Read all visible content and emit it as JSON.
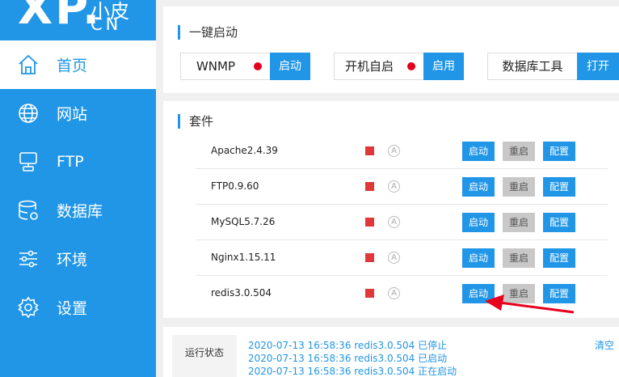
{
  "logo": {
    "big": "XP.",
    "small": "小皮",
    "cn": "CN"
  },
  "nav": [
    {
      "label": "首页",
      "icon": "home-icon",
      "active": true
    },
    {
      "label": "网站",
      "icon": "globe-icon",
      "active": false
    },
    {
      "label": "FTP",
      "icon": "server-icon",
      "active": false
    },
    {
      "label": "数据库",
      "icon": "database-icon",
      "active": false
    },
    {
      "label": "环境",
      "icon": "sliders-icon",
      "active": false
    },
    {
      "label": "设置",
      "icon": "gear-icon",
      "active": false
    }
  ],
  "quick": {
    "title": "一键启动",
    "items": [
      {
        "label": "WNMP",
        "status": "stopped",
        "button": "启动"
      },
      {
        "label": "开机自启",
        "status": "stopped",
        "button": "启用"
      },
      {
        "label": "数据库工具",
        "button": "打开"
      }
    ]
  },
  "suite": {
    "title": "套件",
    "rows": [
      {
        "name": "Apache2.4.39",
        "start": "启动",
        "restart": "重启",
        "config": "配置"
      },
      {
        "name": "FTP0.9.60",
        "start": "启动",
        "restart": "重启",
        "config": "配置"
      },
      {
        "name": "MySQL5.7.26",
        "start": "启动",
        "restart": "重启",
        "config": "配置"
      },
      {
        "name": "Nginx1.15.11",
        "start": "启动",
        "restart": "重启",
        "config": "配置"
      },
      {
        "name": "redis3.0.504",
        "start": "启动",
        "restart": "重启",
        "config": "配置"
      }
    ],
    "auto_icon": "A"
  },
  "log": {
    "label": "运行状态",
    "clear": "清空",
    "lines": [
      "2020-07-13 16:58:36 redis3.0.504 已停止",
      "2020-07-13 16:58:36 redis3.0.504 已启动",
      "2020-07-13 16:58:36 redis3.0.504 正在启动"
    ]
  },
  "colors": {
    "accent": "#2196e7",
    "stopped": "#e03838",
    "dot": "#e4001b",
    "arrow": "#e8001c"
  }
}
